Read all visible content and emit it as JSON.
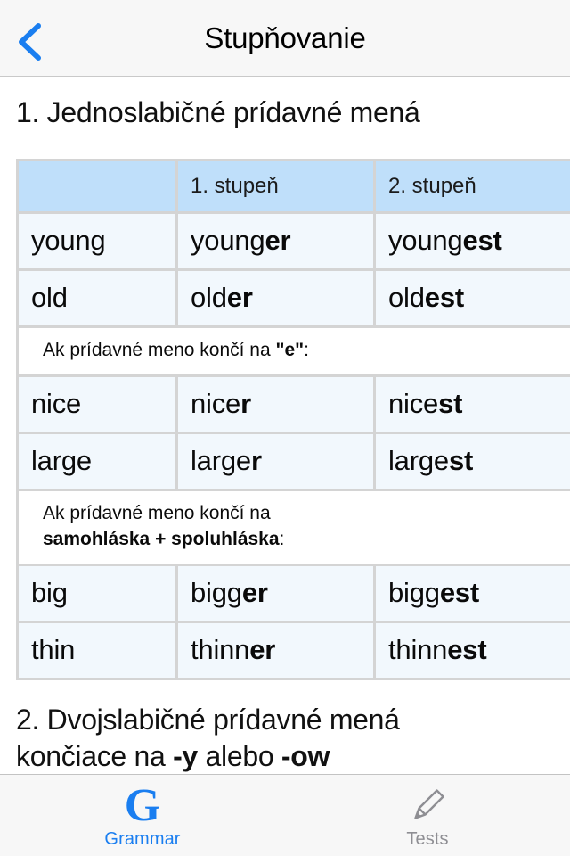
{
  "navbar": {
    "back_icon": "chevron-left-icon",
    "title": "Stupňovanie",
    "accent_color": "#1a7ef0"
  },
  "content": {
    "heading_1": "1. Jednoslabičné prídavné mená",
    "heading_2_line1": "2. Dvojslabičné prídavné mená",
    "heading_2_line2_pre": "končiace na ",
    "heading_2_line2_b1": "-y",
    "heading_2_line2_mid": " alebo ",
    "heading_2_line2_b2": "-ow"
  },
  "table": {
    "header": {
      "col1": "",
      "col2": "1. stupeň",
      "col3": "2. stupeň"
    },
    "header_bg": "#bfdffa",
    "cell_bg": "#f2f8fd",
    "rows": [
      {
        "type": "word",
        "base": "young",
        "comparative_stem": "young",
        "comparative_suffix": "er",
        "superlative_stem": "young",
        "superlative_suffix": "est"
      },
      {
        "type": "word",
        "base": "old",
        "comparative_stem": "old",
        "comparative_suffix": "er",
        "superlative_stem": "old",
        "superlative_suffix": "est"
      },
      {
        "type": "note",
        "note_pre": "Ak prídavné meno končí na ",
        "note_bold": "\"e\"",
        "note_post": ":"
      },
      {
        "type": "word",
        "base": "nice",
        "comparative_stem": "nice",
        "comparative_suffix": "r",
        "superlative_stem": "nice",
        "superlative_suffix": "st"
      },
      {
        "type": "word",
        "base": "large",
        "comparative_stem": "large",
        "comparative_suffix": "r",
        "superlative_stem": "large",
        "superlative_suffix": "st"
      },
      {
        "type": "note2",
        "note_line1": "Ak prídavné meno končí na",
        "note_bold": "samohláska + spoluhláska",
        "note_post": ":"
      },
      {
        "type": "word",
        "base": "big",
        "comparative_stem": "bigg",
        "comparative_suffix": "er",
        "superlative_stem": "bigg",
        "superlative_suffix": "est"
      },
      {
        "type": "word",
        "base": "thin",
        "comparative_stem": "thinn",
        "comparative_suffix": "er",
        "superlative_stem": "thinn",
        "superlative_suffix": "est"
      }
    ]
  },
  "tabbar": {
    "tabs": [
      {
        "label": "Grammar",
        "icon": "letter-g-icon",
        "active": true
      },
      {
        "label": "Tests",
        "icon": "pencil-icon",
        "active": false
      }
    ],
    "active_color": "#1a7ef0",
    "inactive_color": "#8e8e93"
  }
}
